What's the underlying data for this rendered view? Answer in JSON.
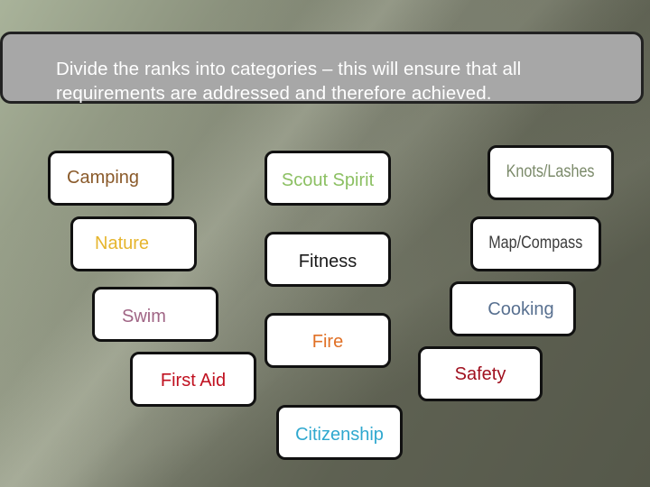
{
  "slide": {
    "intro_text_line1": "Divide the ranks into categories – this will ensure that all",
    "intro_text_line2": "requirements are addressed and therefore achieved."
  },
  "categories": [
    {
      "label": "Camping",
      "color": "#8a5a2a"
    },
    {
      "label": "Nature",
      "color": "#e6b52e"
    },
    {
      "label": "Swim",
      "color": "#a06585"
    },
    {
      "label": "First Aid",
      "color": "#c0101f"
    },
    {
      "label": "Scout Spirit",
      "color": "#8cc063"
    },
    {
      "label": "Fitness",
      "color": "#1a1a1a"
    },
    {
      "label": "Fire",
      "color": "#e07025"
    },
    {
      "label": "Citizenship",
      "color": "#2fa8cf"
    },
    {
      "label": "Knots/Lashes",
      "color": "#7b8a6a"
    },
    {
      "label": "Map/Compass",
      "color": "#3c3c3c"
    },
    {
      "label": "Cooking",
      "color": "#587090"
    },
    {
      "label": "Safety",
      "color": "#a0101f"
    }
  ]
}
